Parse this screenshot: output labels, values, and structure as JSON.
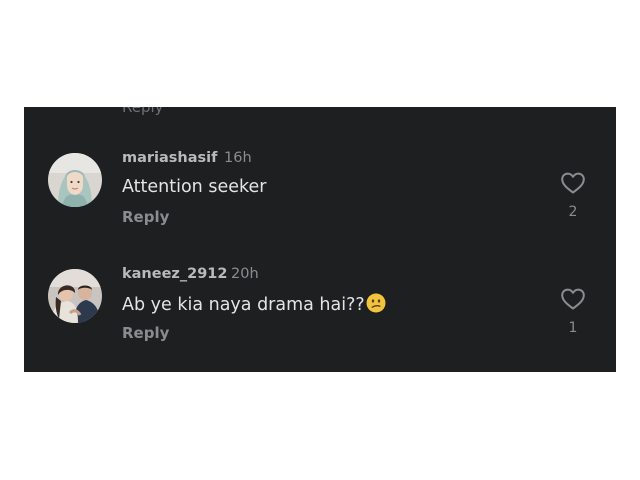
{
  "partial_reply_label": "Reply",
  "comments": [
    {
      "username": "mariashasif",
      "time": "16h",
      "text": "Attention seeker",
      "emoji": "",
      "reply_label": "Reply",
      "like_count": "2",
      "avatar_icon": "user-avatar-hijab-woman"
    },
    {
      "username": "kaneez_2912",
      "time": "20h",
      "text": "Ab ye kia naya drama hai??",
      "emoji": "confused-face-emoji",
      "reply_label": "Reply",
      "like_count": "1",
      "avatar_icon": "user-avatar-couple"
    }
  ],
  "colors": {
    "background": "#1d1f21",
    "username": "#b9babc",
    "text": "#e3e4e6",
    "muted": "#8a8c8f"
  }
}
